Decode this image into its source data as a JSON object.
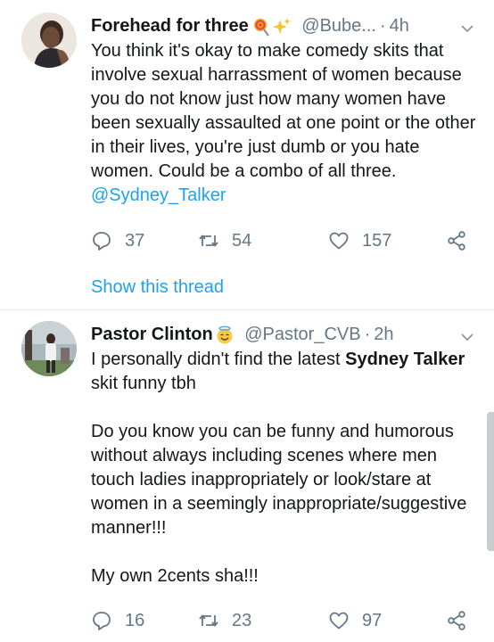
{
  "tweets": [
    {
      "name": "Forehead for three",
      "handle": "@Bube...",
      "time": "4h",
      "body_text": "You think it's okay to make comedy skits that involve sexual harrassment of women because you do not know just how many women have been sexually assaulted at one point or the other in their lives, you're just dumb or you hate women. Could be a combo of all three. ",
      "mention": "@Sydney_Talker",
      "replies": "37",
      "retweets": "54",
      "likes": "157",
      "thread_link": "Show this thread"
    },
    {
      "name": "Pastor Clinton",
      "handle": "@Pastor_CVB",
      "time": "2h",
      "body_pre": "I personally didn't find the latest ",
      "body_bold": "Sydney Talker",
      "body_post": " skit funny tbh\n\nDo you know you can be funny and humorous without always including scenes where men touch ladies inappropriately or look/stare at women in a seemingly inappropriate/suggestive manner!!!\n\nMy own 2cents sha!!!",
      "replies": "16",
      "retweets": "23",
      "likes": "97"
    }
  ],
  "separator": "·",
  "icons": {
    "reply": "reply-icon",
    "retweet": "retweet-icon",
    "like": "heart-icon",
    "share": "share-icon",
    "menu": "chevron-down-icon"
  },
  "colors": {
    "link": "#1da1f2",
    "secondary": "#657786",
    "text": "#14171a",
    "divider": "#e1e8ed"
  }
}
